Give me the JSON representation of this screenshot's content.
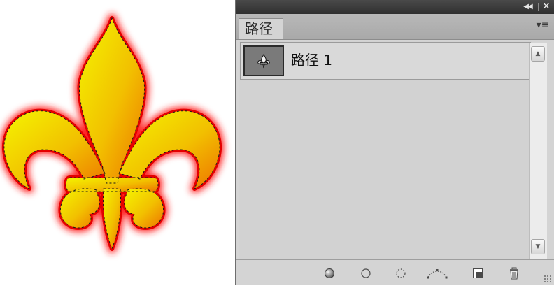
{
  "canvas": {
    "artwork": "fleur-de-lis",
    "selection": "marching-ants-outline",
    "fill_gradient": [
      "#f2f200",
      "#ee7a00"
    ],
    "glow_color": "#ff1a1a"
  },
  "panel": {
    "tab_label": "路径",
    "titlebar_icons": [
      "collapse-icon",
      "close-icon"
    ],
    "menu_icon": "panel-menu-icon",
    "paths": [
      {
        "name": "路径 1",
        "thumbnail": "fleur-de-lis-thumbnail",
        "selected": true
      }
    ],
    "footer_buttons": [
      "fill-path-icon",
      "stroke-path-icon",
      "load-path-as-selection-icon",
      "make-work-path-icon",
      "new-path-icon",
      "delete-path-icon"
    ]
  }
}
